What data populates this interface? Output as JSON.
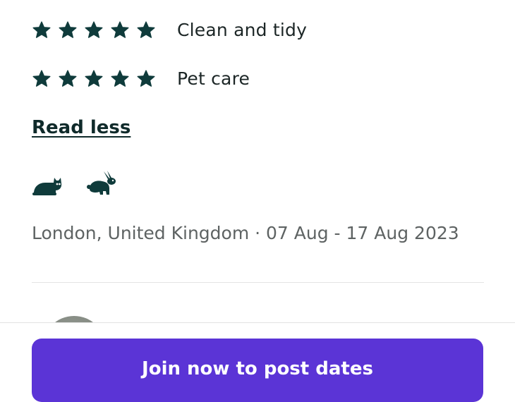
{
  "ratings": [
    {
      "label": "Clean and tidy",
      "stars": 5,
      "max": 5
    },
    {
      "label": "Pet care",
      "stars": 5,
      "max": 5
    }
  ],
  "read_less_label": "Read less",
  "pets": [
    {
      "icon": "cat-icon"
    },
    {
      "icon": "rabbit-icon"
    }
  ],
  "location_line": "London, United Kingdom · 07 Aug - 17 Aug 2023",
  "cta_label": "Join now to post dates",
  "colors": {
    "star": "#0f3b3b",
    "cta_background": "#5b34d6",
    "cta_text": "#ffffff",
    "secondary_text": "#5e6363"
  }
}
